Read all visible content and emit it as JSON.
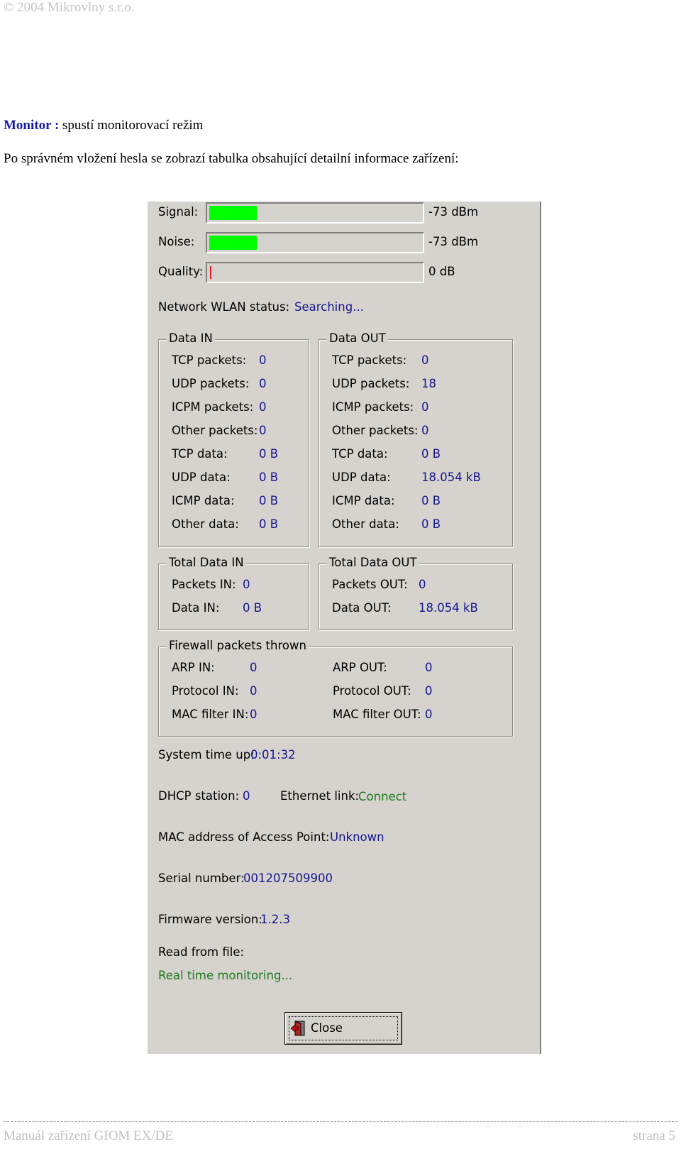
{
  "header": {
    "copyright": "© 2004 Mikrovlny s.r.o."
  },
  "intro": {
    "monitor_label": "Monitor :",
    "monitor_desc": " spustí monitorovací režim",
    "line2": "Po správném vložení hesla se zobrazí tabulka obsahující detailní informace zařízení:"
  },
  "monitor": {
    "signal": {
      "label": "Signal:",
      "value": "-73 dBm",
      "level": 0.22
    },
    "noise": {
      "label": "Noise:",
      "value": "-73 dBm",
      "level": 0.22
    },
    "quality": {
      "label": "Quality:",
      "value": "0 dB",
      "level": 0.0
    },
    "wlan_status": {
      "label": "Network WLAN status:",
      "value": "Searching..."
    },
    "data_in": {
      "title": "Data IN",
      "rows": [
        {
          "label": "TCP packets:",
          "value": "0"
        },
        {
          "label": "UDP packets:",
          "value": "0"
        },
        {
          "label": "ICPM packets:",
          "value": "0"
        },
        {
          "label": "Other packets:",
          "value": "0"
        },
        {
          "label": "TCP data:",
          "value": "0 B"
        },
        {
          "label": "UDP data:",
          "value": "0 B"
        },
        {
          "label": "ICMP data:",
          "value": "0 B"
        },
        {
          "label": "Other data:",
          "value": "0 B"
        }
      ]
    },
    "data_out": {
      "title": "Data OUT",
      "rows": [
        {
          "label": "TCP packets:",
          "value": "0"
        },
        {
          "label": "UDP packets:",
          "value": "18"
        },
        {
          "label": "ICMP packets:",
          "value": "0"
        },
        {
          "label": "Other packets:",
          "value": "0"
        },
        {
          "label": "TCP data:",
          "value": "0 B"
        },
        {
          "label": "UDP data:",
          "value": "18.054 kB"
        },
        {
          "label": "ICMP data:",
          "value": "0 B"
        },
        {
          "label": "Other data:",
          "value": "0 B"
        }
      ]
    },
    "total_in": {
      "title": "Total Data IN",
      "rows": [
        {
          "label": "Packets IN:",
          "value": "0"
        },
        {
          "label": "Data  IN:",
          "value": "0 B"
        }
      ]
    },
    "total_out": {
      "title": "Total Data OUT",
      "rows": [
        {
          "label": "Packets OUT:",
          "value": "0"
        },
        {
          "label": "Data OUT:",
          "value": "18.054 kB"
        }
      ]
    },
    "firewall": {
      "title": "Firewall packets thrown",
      "in_rows": [
        {
          "label": "ARP IN:",
          "value": "0"
        },
        {
          "label": "Protocol IN:",
          "value": "0"
        },
        {
          "label": "MAC filter IN:",
          "value": "0"
        }
      ],
      "out_rows": [
        {
          "label": "ARP OUT:",
          "value": "0"
        },
        {
          "label": "Protocol OUT:",
          "value": "0"
        },
        {
          "label": "MAC filter OUT:",
          "value": "0"
        }
      ]
    },
    "system_time": {
      "label": "System time up:",
      "value": "0:01:32"
    },
    "dhcp": {
      "label": "DHCP station:",
      "value": "0"
    },
    "ethernet": {
      "label": "Ethernet link:",
      "value": "Connect"
    },
    "mac_ap": {
      "label": "MAC address of Access Point:",
      "value": "Unknown"
    },
    "serial": {
      "label": "Serial number:",
      "value": "001207509900"
    },
    "firmware": {
      "label": "Firmware version:",
      "value": "1.2.3"
    },
    "read_from": {
      "label": "Read from file:",
      "value": "Real time monitoring..."
    },
    "close_button": {
      "label": "Close",
      "icon": "exit-door-icon"
    }
  },
  "footer": {
    "left": "Manuál zařízení GIOM EX/DE",
    "right": "strana 5"
  }
}
